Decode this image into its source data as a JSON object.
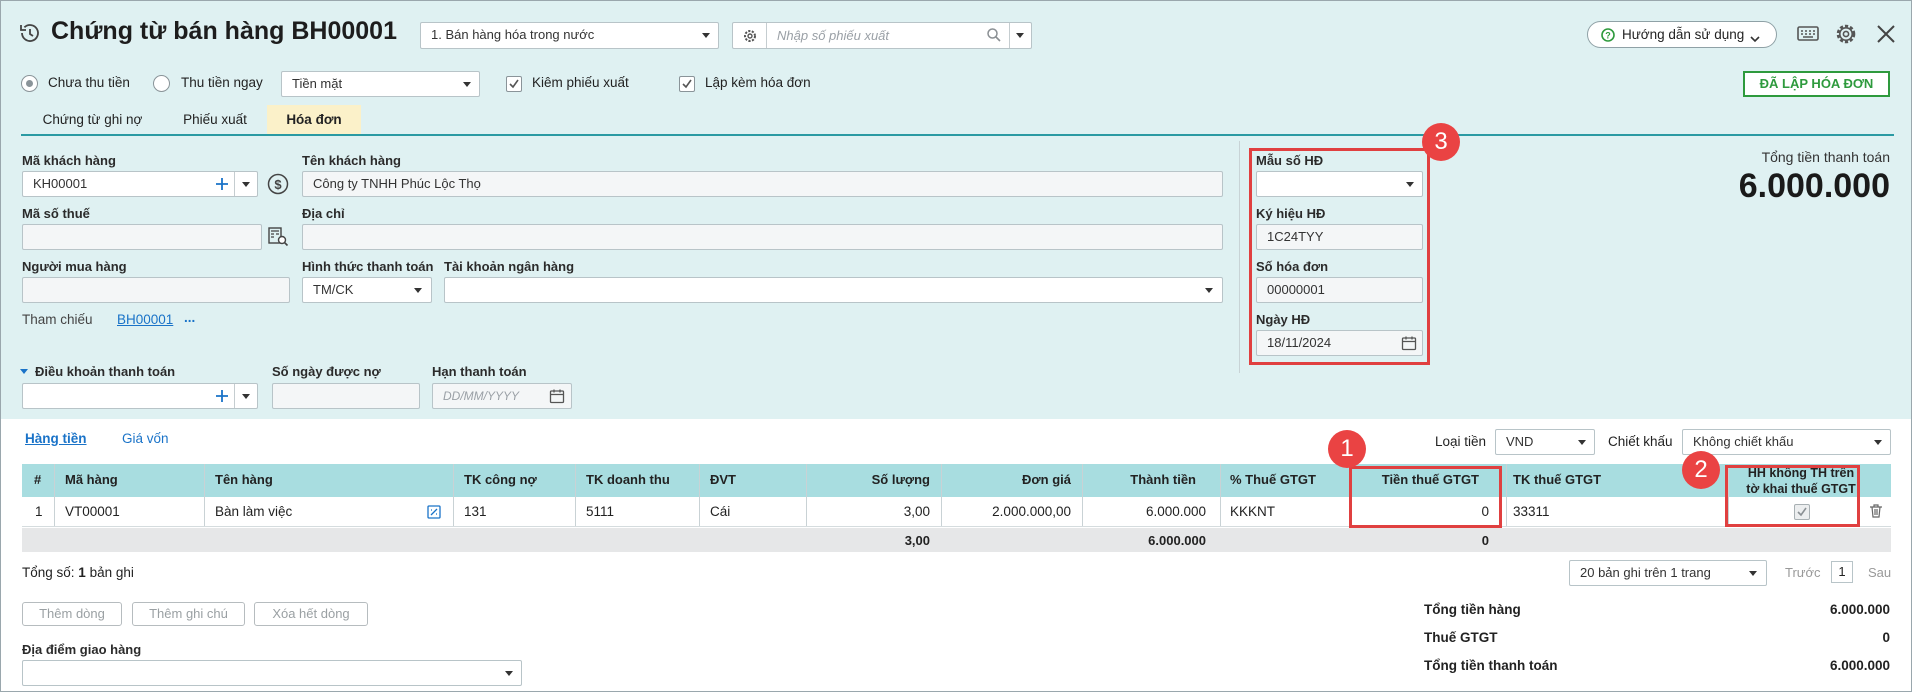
{
  "header": {
    "title": "Chứng từ bán hàng BH00001",
    "type_select": "1. Bán hàng hóa trong nước",
    "search_placeholder": "Nhập số phiếu xuất",
    "help_label": "Hướng dẫn sử dụng"
  },
  "options": {
    "radio_unpaid": "Chưa thu tiền",
    "radio_paid": "Thu tiền ngay",
    "payment_method": "Tiền mặt",
    "chk_export": "Kiêm phiếu xuất",
    "chk_invoice": "Lập kèm hóa đơn",
    "status_button": "ĐÃ LẬP HÓA ĐƠN"
  },
  "tabs": [
    "Chứng từ ghi nợ",
    "Phiếu xuất",
    "Hóa đơn"
  ],
  "form": {
    "customer_code_label": "Mã khách hàng",
    "customer_code": "KH00001",
    "customer_name_label": "Tên khách hàng",
    "customer_name": "Công ty TNHH Phúc Lộc Thọ",
    "tax_code_label": "Mã số thuế",
    "tax_code": "",
    "address_label": "Địa chỉ",
    "address": "",
    "buyer_label": "Người mua hàng",
    "buyer": "",
    "payment_form_label": "Hình thức thanh toán",
    "payment_form": "TM/CK",
    "bank_account_label": "Tài khoản ngân hàng",
    "bank_account": "",
    "reference_label": "Tham chiếu",
    "reference_link": "BH00001",
    "reference_more": "...",
    "payment_terms_label": "Điều khoản thanh toán",
    "payment_terms": "",
    "credit_days_label": "Số ngày được nợ",
    "credit_days": "",
    "due_date_label": "Hạn thanh toán",
    "due_date_placeholder": "DD/MM/YYYY"
  },
  "invoice": {
    "template_label": "Mẫu số HĐ",
    "template": "",
    "symbol_label": "Ký hiệu HĐ",
    "symbol": "1C24TYY",
    "number_label": "Số hóa đơn",
    "number": "00000001",
    "date_label": "Ngày HĐ",
    "date": "18/11/2024"
  },
  "total": {
    "label": "Tổng tiền thanh toán",
    "value": "6.000.000"
  },
  "subtabs": {
    "goods": "Hàng tiền",
    "cost": "Giá vốn",
    "currency_label": "Loại tiền",
    "currency": "VND",
    "discount_label": "Chiết khấu",
    "discount": "Không chiết khấu"
  },
  "table": {
    "headers": {
      "no": "#",
      "code": "Mã hàng",
      "name": "Tên hàng",
      "debit_acc": "TK công nợ",
      "revenue_acc": "TK doanh thu",
      "unit": "ĐVT",
      "qty": "Số lượng",
      "price": "Đơn giá",
      "amount": "Thành tiền",
      "vat_rate": "% Thuế GTGT",
      "vat_amount": "Tiền thuế GTGT",
      "vat_acc": "TK thuế GTGT",
      "not_declared_1": "HH không TH trên",
      "not_declared_2": "tờ khai thuế GTGT"
    },
    "row": {
      "no": "1",
      "code": "VT00001",
      "name": "Bàn làm việc",
      "debit_acc": "131",
      "revenue_acc": "5111",
      "unit": "Cái",
      "qty": "3,00",
      "price": "2.000.000,00",
      "amount": "6.000.000",
      "vat_rate": "KKKNT",
      "vat_amount": "0",
      "vat_acc": "33311",
      "not_declared": true
    },
    "footer": {
      "qty": "3,00",
      "amount": "6.000.000",
      "vat_amount": "0"
    }
  },
  "paging": {
    "total_prefix": "Tổng số:",
    "total_count": "1",
    "total_suffix": "bản ghi",
    "page_size": "20 bản ghi trên 1 trang",
    "prev": "Trước",
    "page": "1",
    "next": "Sau"
  },
  "actions": {
    "add_row": "Thêm dòng",
    "add_note": "Thêm ghi chú",
    "clear_rows": "Xóa hết dòng"
  },
  "delivery": {
    "label": "Địa điểm giao hàng",
    "value": ""
  },
  "summary": {
    "goods_label": "Tổng tiền hàng",
    "goods_value": "6.000.000",
    "vat_label": "Thuế GTGT",
    "vat_value": "0",
    "total_label": "Tổng tiền thanh toán",
    "total_value": "6.000.000"
  },
  "annotations": [
    "1",
    "2",
    "3"
  ],
  "colors": {
    "top_bg": "#dff1f2",
    "header_row": "#a8dde0",
    "green": "#2e9a3d",
    "red": "#e04040",
    "link": "#1a73c8"
  }
}
